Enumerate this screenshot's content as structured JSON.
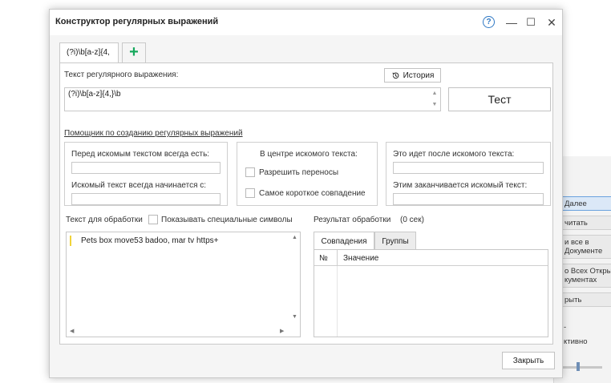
{
  "dialog": {
    "title": "Конструктор регулярных выражений",
    "help_glyph": "?",
    "minimize_glyph": "—",
    "maximize_glyph": "☐",
    "close_glyph": "✕"
  },
  "tabs": {
    "regex_tab_label": "(?i)\\b[a-z]{4,",
    "add_glyph": "+"
  },
  "regex": {
    "label": "Текст регулярного выражения:",
    "value": "(?i)\\b[a-z]{4,}\\b",
    "history_label": "История",
    "test_label": "Тест"
  },
  "helper": {
    "link": "Помощник по созданию регулярных выражений",
    "before_label": "Перед искомым текстом всегда есть:",
    "starts_label": "Искомый текст всегда начинается с:",
    "center_label": "В центре искомого текста:",
    "allow_wrap_label": "Разрешить переносы",
    "shortest_label": "Самое короткое совпадение",
    "after_label": "Это идет после искомого текста:",
    "ends_label": "Этим заканчивается искомый текст:"
  },
  "processing": {
    "label": "Текст для обработки",
    "show_special_label": "Показывать специальные символы",
    "text": "Pets box move53 badoo, mar tv https+"
  },
  "result": {
    "label": "Результат обработки",
    "time": "(0 сек)",
    "tab_matches": "Совпадения",
    "tab_groups": "Группы",
    "col_no": "№",
    "col_value": "Значение"
  },
  "footer": {
    "close_label": "Закрыть"
  },
  "background_window": {
    "buttons": [
      "Далее",
      "читать",
      "и все в\nДокументе",
      "о Всех Откры\nкументах",
      "рыть"
    ],
    "text_1": "-",
    "text_2": "ктивно"
  },
  "colors": {
    "accent": "#2f78c4",
    "add_tab": "#15a85c",
    "caret_line": "#f0d33a"
  }
}
